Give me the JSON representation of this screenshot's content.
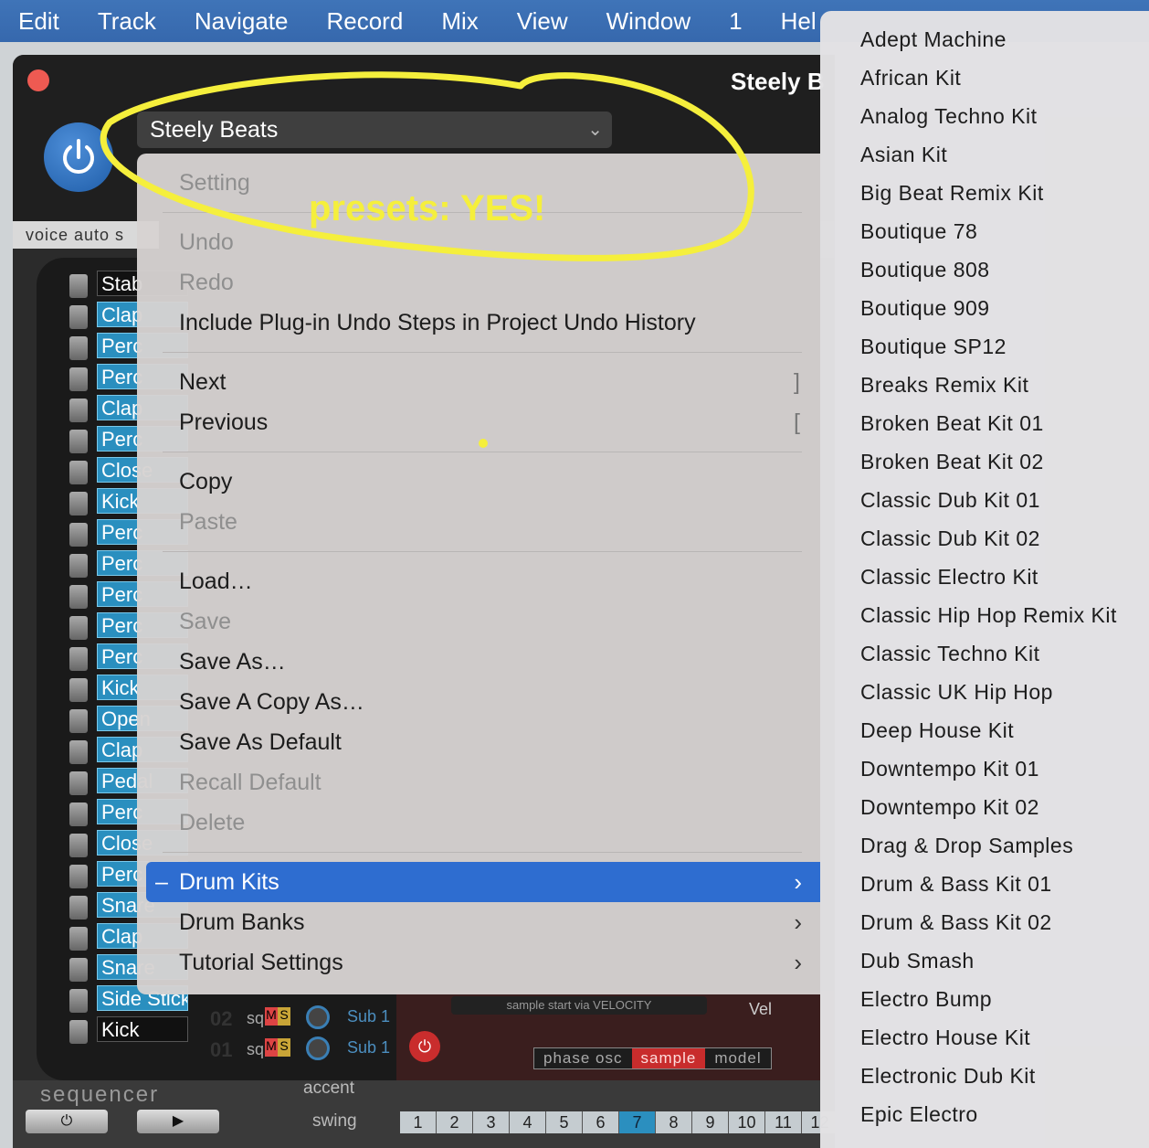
{
  "menubar": {
    "items": [
      "Edit",
      "Track",
      "Navigate",
      "Record",
      "Mix",
      "View",
      "Window",
      "1",
      "Hel"
    ]
  },
  "plugin": {
    "title": "Steely B",
    "preset_name": "Steely Beats",
    "voice_strip": "voice auto s",
    "tracks": [
      "Stab",
      "Clap",
      "Perc",
      "Perc",
      "Clap",
      "Perc",
      "Close",
      "Kick",
      "Perc",
      "Perc",
      "Perc",
      "Perc",
      "Perc",
      "Kick",
      "Open",
      "Clap",
      "Pedal",
      "Perc",
      "Close",
      "Perc",
      "Snare",
      "Clap",
      "Snare",
      "Side Stick",
      "Kick"
    ],
    "bottom_tracks": [
      {
        "num": "02",
        "sq": "sq",
        "m": "M",
        "s": "S",
        "sub": "Sub  1"
      },
      {
        "num": "01",
        "sq": "sq",
        "m": "M",
        "s": "S",
        "sub": "Sub  1"
      }
    ],
    "sample_start": "sample start via VELOCITY",
    "vel_label": "Vel",
    "synth_power": "⏻",
    "modes": [
      "phase osc",
      "sample",
      "model"
    ],
    "sequencer": {
      "title": "sequencer",
      "accent": "accent",
      "swing": "swing",
      "power": "⏻",
      "play": "▶",
      "steps": [
        "1",
        "2",
        "3",
        "4",
        "5",
        "6",
        "7",
        "8",
        "9",
        "10",
        "11",
        "12"
      ]
    }
  },
  "context_menu": {
    "setting": "Setting",
    "undo": "Undo",
    "redo": "Redo",
    "include_undo": "Include Plug-in Undo Steps in Project Undo History",
    "next": "Next",
    "next_shortcut": "]",
    "previous": "Previous",
    "previous_shortcut": "[",
    "copy": "Copy",
    "paste": "Paste",
    "load": "Load…",
    "save": "Save",
    "save_as": "Save As…",
    "save_copy_as": "Save A Copy As…",
    "save_default": "Save As Default",
    "recall_default": "Recall Default",
    "delete": "Delete",
    "drum_kits": "Drum Kits",
    "drum_banks": "Drum Banks",
    "tutorial_settings": "Tutorial Settings"
  },
  "submenu": {
    "items": [
      "Adept Machine",
      "African Kit",
      "Analog Techno Kit",
      "Asian Kit",
      "Big Beat Remix Kit",
      "Boutique 78",
      "Boutique 808",
      "Boutique 909",
      "Boutique SP12",
      "Breaks Remix Kit",
      "Broken Beat Kit 01",
      "Broken Beat Kit 02",
      "Classic Dub Kit 01",
      "Classic Dub Kit 02",
      "Classic Electro Kit",
      "Classic Hip Hop Remix Kit",
      "Classic Techno Kit",
      "Classic UK Hip Hop",
      "Deep House Kit",
      "Downtempo Kit 01",
      "Downtempo Kit 02",
      "Drag & Drop Samples",
      "Drum & Bass Kit 01",
      "Drum & Bass Kit 02",
      "Dub Smash",
      "Electro Bump",
      "Electro House Kit",
      "Electronic Dub Kit",
      "Epic Electro"
    ]
  },
  "annotation": {
    "text": "presets: YES!",
    "color": "#f5ef3c"
  },
  "colors": {
    "menubar": "#3668ad",
    "highlight": "#2e6dd0",
    "track_label": "#2a8fbf"
  }
}
